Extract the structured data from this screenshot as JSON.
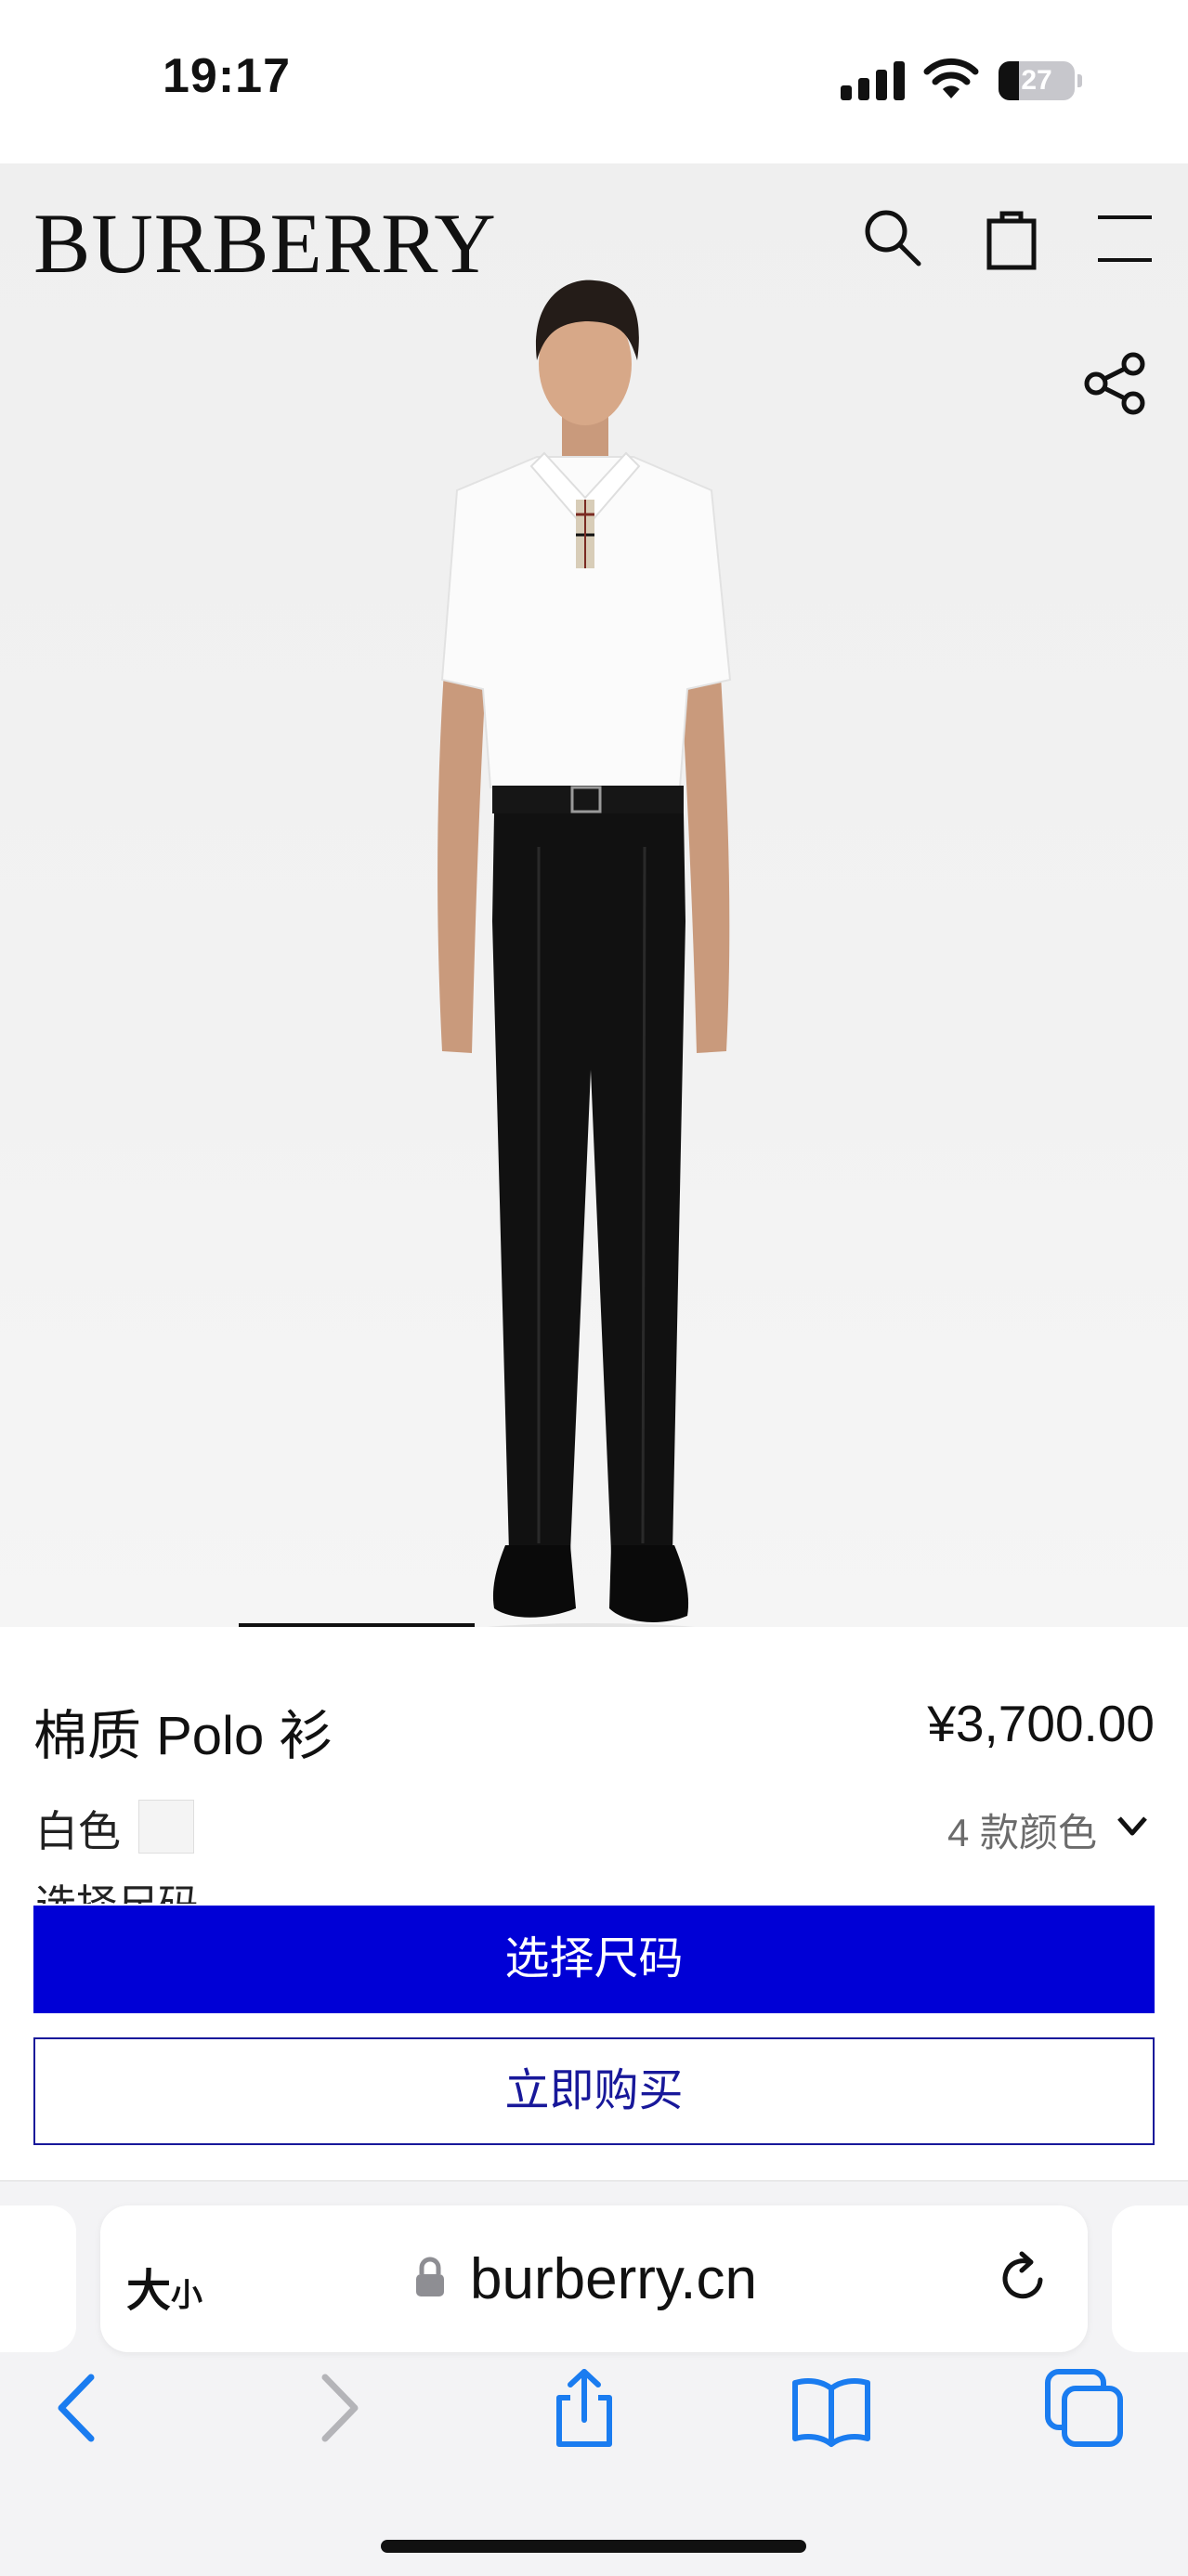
{
  "status_bar": {
    "time": "19:17",
    "battery_level": "27",
    "battery_fraction": 0.27,
    "icons": [
      "cellular-signal-icon",
      "wifi-icon",
      "battery-icon"
    ]
  },
  "header": {
    "logo": "BURBERRY",
    "icons": [
      "search-icon",
      "shopping-bag-icon",
      "menu-icon",
      "share-icon"
    ]
  },
  "product": {
    "name": "棉质 Polo 衫",
    "price": "¥3,700.00",
    "color_label": "白色",
    "color_count": "4 款颜色",
    "size_label": "选择尺码",
    "image_carousel": {
      "current_index": 2
    }
  },
  "actions": {
    "select_size": "选择尺码",
    "buy_now": "立即购买"
  },
  "browser": {
    "text_size_big": "大",
    "text_size_small": "小",
    "url": "burberry.cn",
    "toolbar_icons": [
      "back-icon",
      "forward-icon",
      "share-sheet-icon",
      "bookmarks-icon",
      "tabs-icon"
    ]
  },
  "colors": {
    "primary_button": "#0000d6",
    "secondary_button_border": "#18189a",
    "ios_blue": "#1a7cf0",
    "background": "#ffffff"
  }
}
